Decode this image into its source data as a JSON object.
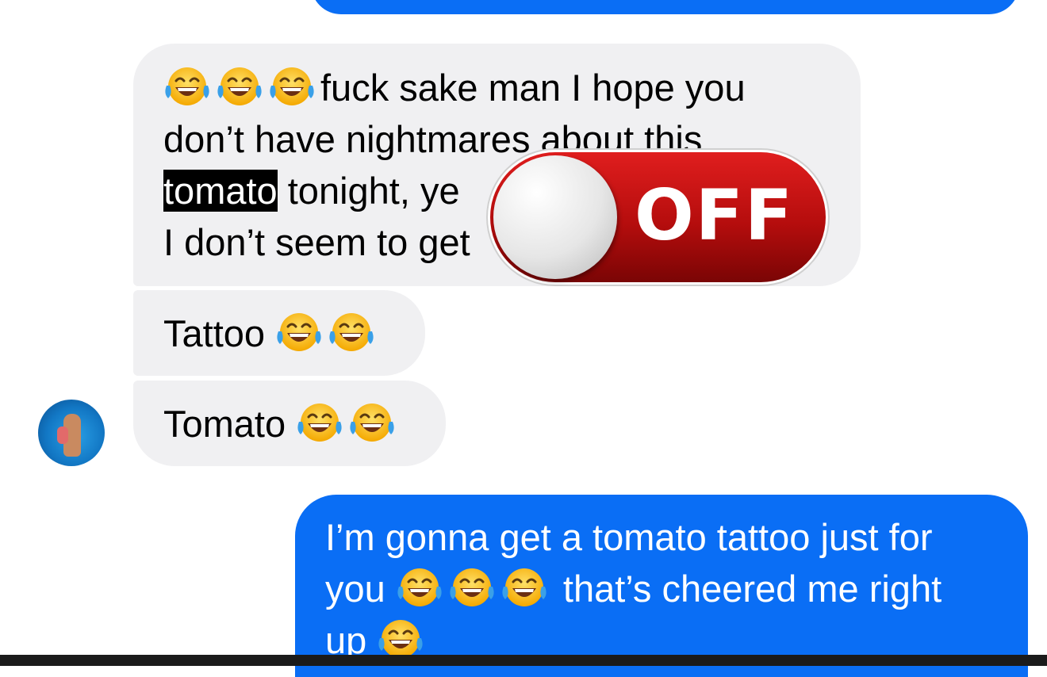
{
  "messages": [
    {
      "direction": "incoming",
      "lines": [
        {
          "emoji_before": 3,
          "text": "fuck sake man I hope you"
        },
        {
          "text": "don’t have nightmares about this"
        },
        {
          "highlight": "tomato",
          "text": " tonight, ye"
        },
        {
          "text": "I don’t seem to get"
        }
      ]
    },
    {
      "direction": "incoming",
      "text": "Tattoo",
      "emoji_after": 2
    },
    {
      "direction": "incoming",
      "text": "Tomato",
      "emoji_after": 2
    },
    {
      "direction": "outgoing",
      "lines": [
        {
          "text": "I’m gonna get a tomato tattoo just for"
        },
        {
          "text_before": "you",
          "emoji": 3,
          "text_after": "that’s cheered me right"
        },
        {
          "text_before": "up",
          "emoji": 1
        }
      ]
    }
  ],
  "emoji_name": "face-with-tears-of-joy",
  "toggle": {
    "label": "OFF",
    "state": "off"
  },
  "colors": {
    "incoming_bubble": "#f0f0f2",
    "outgoing_bubble": "#0a6ef5",
    "toggle_red": "#c81010"
  }
}
